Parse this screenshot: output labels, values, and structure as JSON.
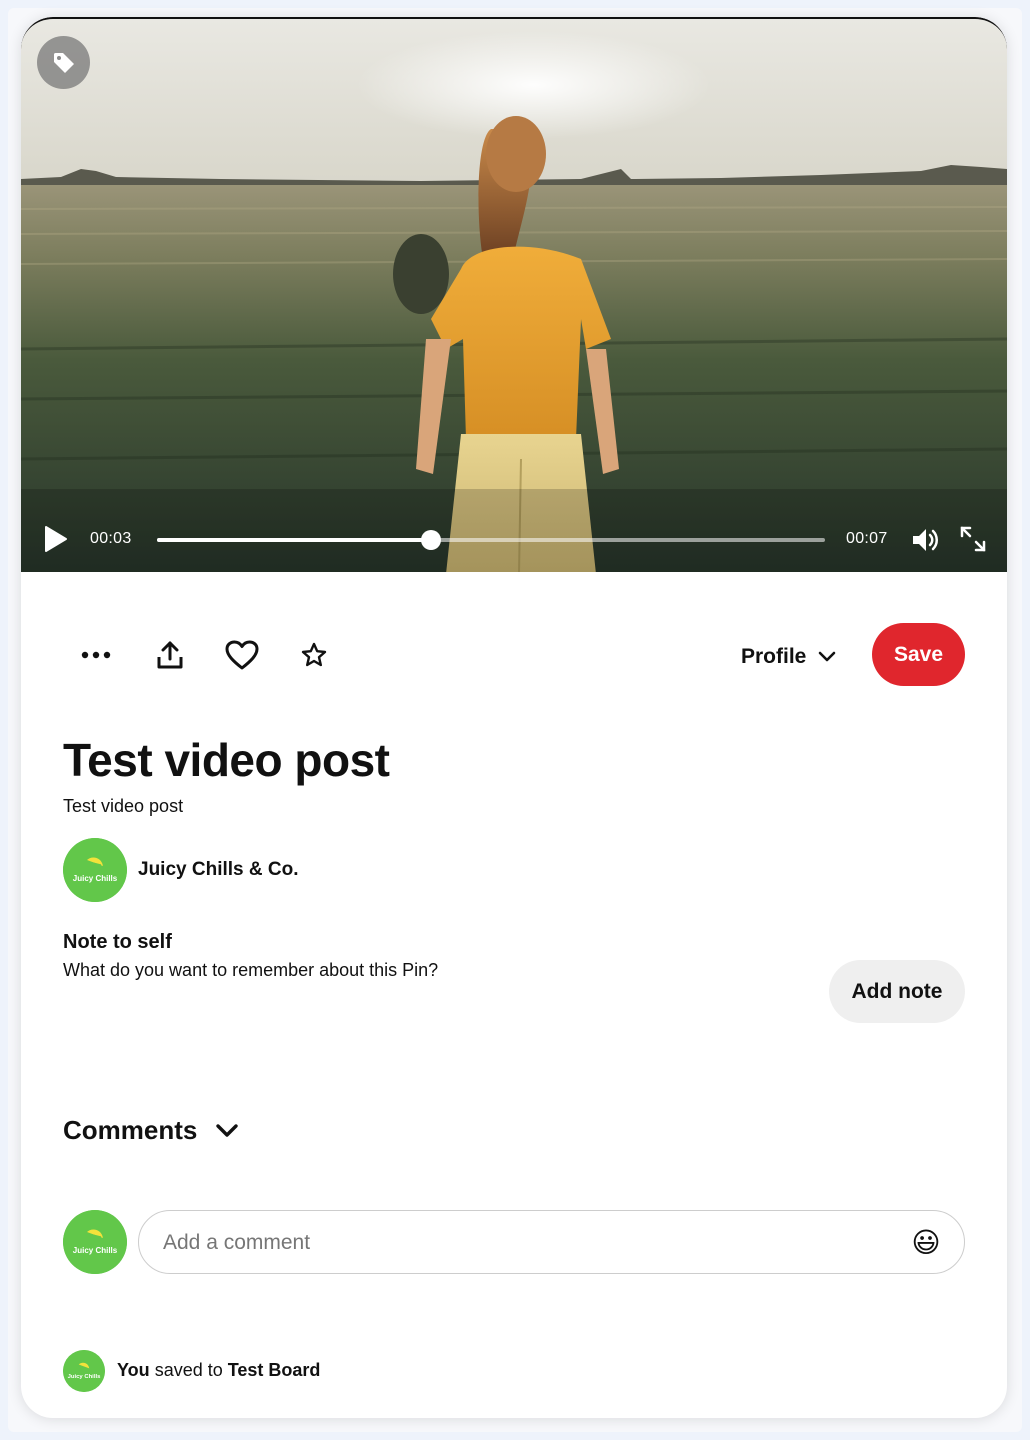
{
  "video": {
    "current_time": "00:03",
    "total_time": "00:07",
    "progress": 0.41
  },
  "actions": {
    "more_icon": "more-dots-icon",
    "share_icon": "share-upload-icon",
    "like_icon": "heart-icon",
    "favorite_icon": "star-icon",
    "board_select": "Profile",
    "save_label": "Save"
  },
  "pin": {
    "title": "Test video post",
    "description": "Test video post"
  },
  "author": {
    "name": "Juicy Chills & Co.",
    "logo_text": "Juicy Chills"
  },
  "note": {
    "title": "Note to self",
    "description": "What do you want to remember about this Pin?",
    "add_label": "Add note"
  },
  "comments": {
    "heading": "Comments",
    "placeholder": "Add a comment",
    "emoji": "😃"
  },
  "saved": {
    "who": "You",
    "middle": "saved to",
    "board": "Test Board"
  },
  "colors": {
    "save_button": "#e0262d",
    "avatar": "#62c74a",
    "note_button": "#efefef"
  }
}
